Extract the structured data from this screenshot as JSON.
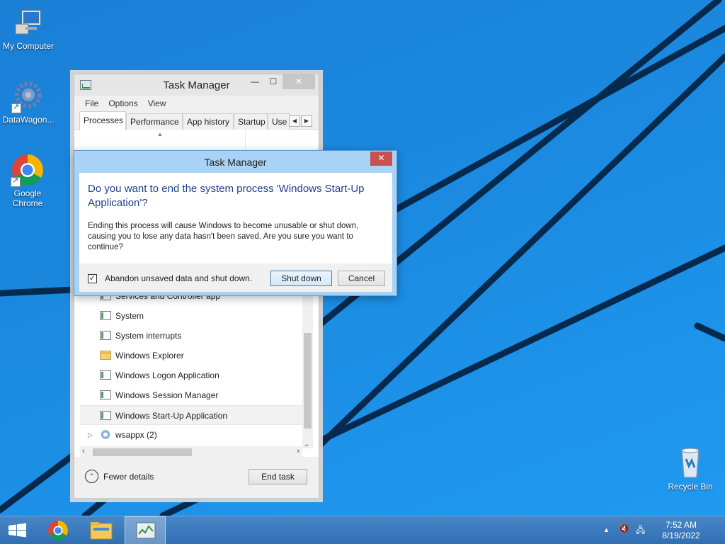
{
  "desktop": {
    "icons": [
      {
        "label": "My Computer",
        "icon": "computer-icon"
      },
      {
        "label": "DataWagon...",
        "icon": "gear-icon"
      },
      {
        "label": "Google Chrome",
        "icon": "chrome-icon"
      },
      {
        "label": "Recycle Bin",
        "icon": "recycle-bin-icon"
      }
    ]
  },
  "task_manager": {
    "title": "Task Manager",
    "menu": [
      "File",
      "Options",
      "View"
    ],
    "tabs": [
      "Processes",
      "Performance",
      "App history",
      "Startup",
      "Use"
    ],
    "active_tab": "Processes",
    "processes": [
      {
        "name": "Services and Controller app",
        "icon": "process-icon"
      },
      {
        "name": "System",
        "icon": "process-icon"
      },
      {
        "name": "System interrupts",
        "icon": "process-icon"
      },
      {
        "name": "Windows Explorer",
        "icon": "folder-icon"
      },
      {
        "name": "Windows Logon Application",
        "icon": "process-icon"
      },
      {
        "name": "Windows Session Manager",
        "icon": "process-icon"
      },
      {
        "name": "Windows Start-Up Application",
        "icon": "process-icon",
        "selected": true
      },
      {
        "name": "wsappx (2)",
        "icon": "gear-icon",
        "expandable": true
      }
    ],
    "fewer_details": "Fewer details",
    "end_task": "End task"
  },
  "dialog": {
    "title": "Task Manager",
    "heading": "Do you want to end the system process 'Windows Start-Up Application'?",
    "message": "Ending this process will cause Windows to become unusable or shut down, causing you to lose any data hasn't been saved. Are you sure you want to continue?",
    "checkbox_label": "Abandon unsaved data and shut down.",
    "checkbox_checked": true,
    "primary_button": "Shut down",
    "cancel_button": "Cancel"
  },
  "taskbar": {
    "pinned": [
      "start-button",
      "chrome-icon",
      "file-explorer-icon",
      "task-manager-icon"
    ],
    "active": "task-manager-icon",
    "time": "7:52 AM",
    "date": "8/19/2022"
  },
  "colors": {
    "desktop_blue": "#1b8ae0",
    "dialog_frame": "#a8d3f5",
    "dialog_heading": "#1e3f8e",
    "close_red": "#c75050"
  }
}
